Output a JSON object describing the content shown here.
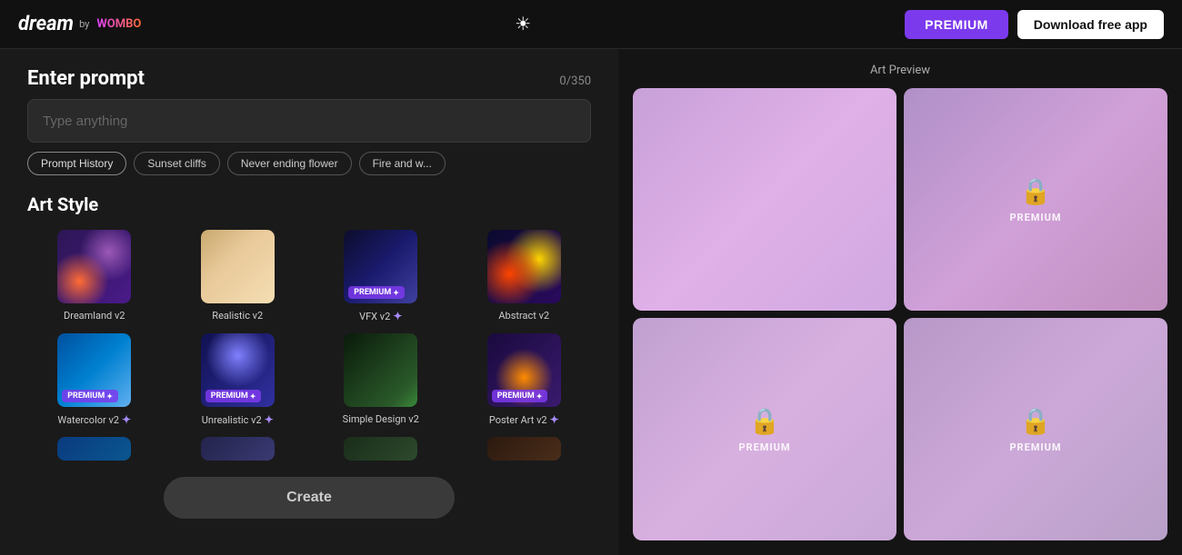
{
  "header": {
    "logo_dream": "dream",
    "logo_by": "by",
    "logo_wombo": "WOMBO",
    "btn_premium_label": "PREMIUM",
    "btn_download_label": "Download free app"
  },
  "prompt_section": {
    "label": "Enter prompt",
    "placeholder": "Type anything",
    "char_count": "0/350"
  },
  "prompt_chips": [
    {
      "label": "Prompt History",
      "type": "history"
    },
    {
      "label": "Sunset cliffs",
      "type": "suggestion"
    },
    {
      "label": "Never ending flower",
      "type": "suggestion"
    },
    {
      "label": "Fire and w...",
      "type": "suggestion"
    }
  ],
  "art_style_section": {
    "title": "Art Style",
    "items": [
      {
        "name": "Dreamland v2",
        "premium": false,
        "style_class": "art-dreamland"
      },
      {
        "name": "Realistic v2",
        "premium": false,
        "style_class": "art-realistic"
      },
      {
        "name": "VFX v2",
        "premium": true,
        "style_class": "art-vfx",
        "plus": true
      },
      {
        "name": "Abstract v2",
        "premium": false,
        "style_class": "art-abstract"
      },
      {
        "name": "Watercolor v2",
        "premium": true,
        "style_class": "art-watercolor",
        "plus": true
      },
      {
        "name": "Unrealistic v2",
        "premium": true,
        "style_class": "art-unrealistic",
        "plus": true
      },
      {
        "name": "Simple Design v2",
        "premium": false,
        "style_class": "art-simple"
      },
      {
        "name": "Poster Art v2",
        "premium": true,
        "style_class": "art-poster",
        "plus": true
      }
    ]
  },
  "create_button": {
    "label": "Create"
  },
  "preview_section": {
    "title": "Art Preview",
    "cells": [
      {
        "id": 1,
        "is_free": true,
        "premium_label": ""
      },
      {
        "id": 2,
        "is_free": false,
        "premium_label": "PREMIUM"
      },
      {
        "id": 3,
        "is_free": false,
        "premium_label": "PREMIUM"
      },
      {
        "id": 4,
        "is_free": false,
        "premium_label": "PREMIUM"
      }
    ]
  },
  "icons": {
    "theme_toggle": "☀",
    "lock": "🔒",
    "premium_star": "✦"
  }
}
